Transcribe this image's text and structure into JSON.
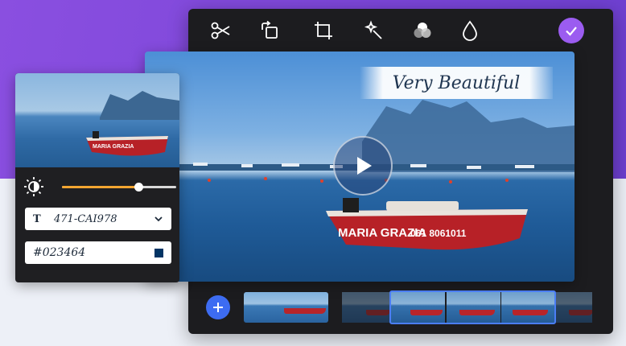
{
  "editor": {
    "toolbar": {
      "tools": [
        {
          "name": "cut",
          "icon": "scissors-icon"
        },
        {
          "name": "rotate",
          "icon": "rotate-icon"
        },
        {
          "name": "crop",
          "icon": "crop-icon"
        },
        {
          "name": "magic",
          "icon": "magic-wand-icon"
        },
        {
          "name": "filters",
          "icon": "color-circles-icon"
        },
        {
          "name": "color",
          "icon": "droplet-icon"
        }
      ],
      "confirm_icon": "checkmark-icon",
      "confirm_color": "#9b5cf0"
    },
    "preview": {
      "title_text": "Very Beautiful",
      "boat_text": "MARIA GRAZIA",
      "boat_number": "061 8061011",
      "play_icon": "play-icon"
    }
  },
  "adjust_panel": {
    "brightness_icon": "brightness-icon",
    "brightness_level": 0.67,
    "slider_color": "#f3a531",
    "font_icon": "T",
    "font_name": "471-CAI978",
    "font_dropdown_icon": "chevron-down-icon",
    "color_hex": "#023464",
    "color_swatch": "#023464",
    "thumb_boat_text": "MARIA GRAZIA"
  },
  "timeline": {
    "add_icon": "plus-icon",
    "accent": "#3d6cf2",
    "selection_color": "#4b7ef5"
  },
  "colors": {
    "background_top": "#7b45d8",
    "background_bottom": "#edf0f7",
    "editor_bg": "#1c1c1f"
  }
}
